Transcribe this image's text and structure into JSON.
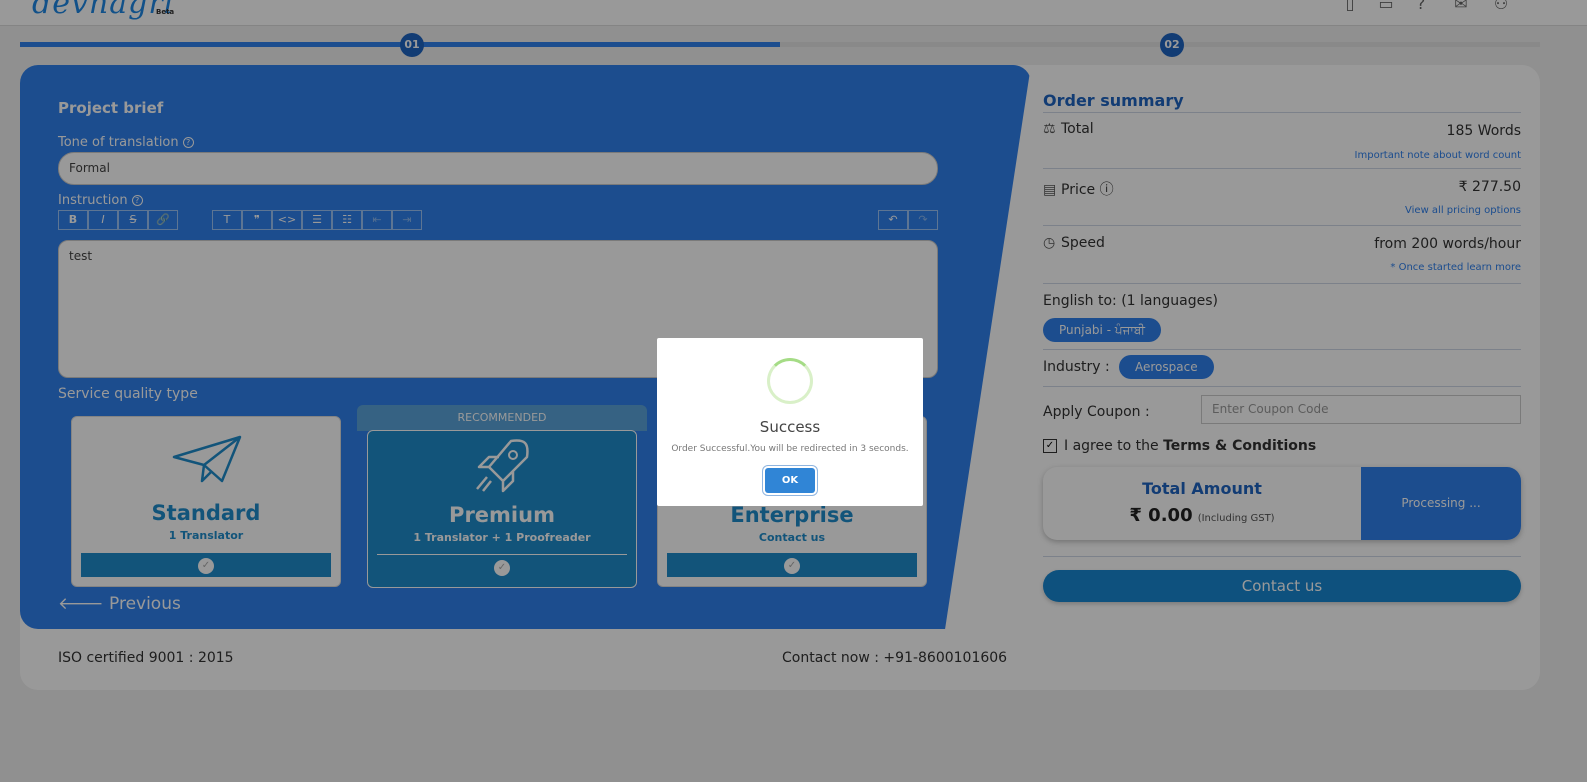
{
  "header": {
    "logo": "devnagri",
    "beta": "Beta"
  },
  "steps": [
    "01",
    "02"
  ],
  "form": {
    "section_title": "Project brief",
    "tone_label": "Tone of translation",
    "tone_value": "Formal",
    "instruction_label": "Instruction",
    "toolbar": [
      "B",
      "I",
      "S",
      "🔗",
      "T",
      "❞",
      "<>",
      "☰",
      "☷",
      "⇤",
      "⇥",
      "↶",
      "↷"
    ],
    "instruction_text": "test",
    "service_label": "Service quality type",
    "recommended": "RECOMMENDED",
    "cards": [
      {
        "title": "Standard",
        "subtitle": "1 Translator"
      },
      {
        "title": "Premium",
        "subtitle": "1 Translator + 1 Proofreader"
      },
      {
        "title": "Enterprise",
        "subtitle": "Contact us"
      }
    ],
    "previous": "Previous"
  },
  "footer": {
    "iso": "ISO certified 9001 : 2015",
    "contact": "Contact now : +91-8600101606"
  },
  "summary": {
    "title": "Order summary",
    "total_label": "Total",
    "total_value": "185 Words",
    "total_note": "Important note about word count",
    "price_label": "Price",
    "price_value": "₹ 277.50",
    "price_note": "View all pricing options",
    "speed_label": "Speed",
    "speed_value": "from 200 words/hour",
    "speed_note": "* Once started learn more",
    "languages_label": "English to: (1 languages)",
    "language_pill": "Punjabi - ਪੰਜਾਬੀ",
    "industry_label": "Industry :",
    "industry_pill": "Aerospace",
    "coupon_label": "Apply Coupon :",
    "coupon_placeholder": "Enter Coupon Code",
    "terms_prefix": "I agree to the",
    "terms_link": "Terms & Conditions",
    "amount_label": "Total Amount",
    "amount_value": "₹ 0.00",
    "amount_note": "(Including GST)",
    "processing": "Processing ...",
    "contact_button": "Contact us"
  },
  "modal": {
    "title": "Success",
    "message": "Order Successful.You will be redirected in 3 seconds.",
    "ok": "OK"
  }
}
